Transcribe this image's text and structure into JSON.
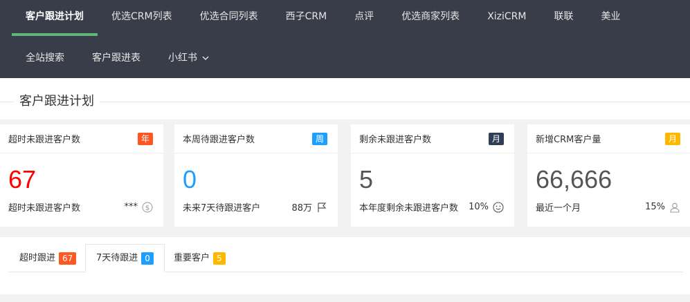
{
  "nav": {
    "primary": [
      "客户跟进计划",
      "优选CRM列表",
      "优选合同列表",
      "西子CRM",
      "点评",
      "优选商家列表",
      "XiziCRM",
      "联联",
      "美业"
    ],
    "secondary": [
      "全站搜索",
      "客户跟进表",
      "小红书"
    ]
  },
  "page": {
    "title": "客户跟进计划"
  },
  "cards": [
    {
      "title": "超时未跟进客户数",
      "badge": "年",
      "badge_color": "#ff5722",
      "value": "67",
      "value_color": "#ff0000",
      "foot_label": "超时未跟进客户数",
      "foot_value": "***",
      "icon": "dollar-circle-icon"
    },
    {
      "title": "本周待跟进客户数",
      "badge": "周",
      "badge_color": "#1e9fff",
      "value": "0",
      "value_color": "#1e9fff",
      "foot_label": "未来7天待跟进客户",
      "foot_value": "88万",
      "icon": "flag-icon"
    },
    {
      "title": "剩余未跟进客户数",
      "badge": "月",
      "badge_color": "#2f4056",
      "value": "5",
      "value_color": "#555555",
      "foot_label": "本年度剩余未跟进客户数",
      "foot_value": "10%",
      "icon": "smile-icon"
    },
    {
      "title": "新增CRM客户量",
      "badge": "月",
      "badge_color": "#ffb800",
      "value": "66,666",
      "value_color": "#555555",
      "foot_label": "最近一个月",
      "foot_value": "15%",
      "icon": "user-icon"
    }
  ],
  "tabs": [
    {
      "label": "超时跟进",
      "count": "67",
      "color": "#ff5722"
    },
    {
      "label": "7天待跟进",
      "count": "0",
      "color": "#1e9fff"
    },
    {
      "label": "重要客户",
      "count": "5",
      "color": "#ffb800"
    }
  ]
}
